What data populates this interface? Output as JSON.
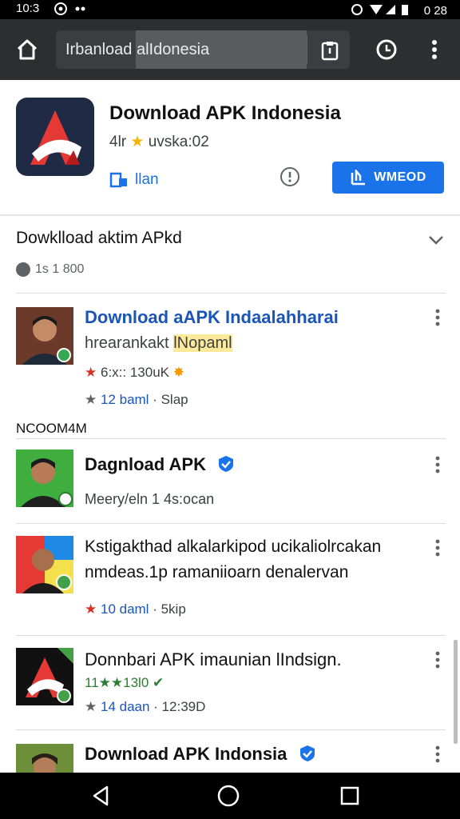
{
  "status_bar": {
    "time": "10:3",
    "battery_text": "0 28"
  },
  "browser": {
    "url": "Irbanload alIdonesia"
  },
  "app": {
    "title": "Download APK Indonesia",
    "subtitle_left": "4lr",
    "subtitle_right": "uvska:02",
    "link_label": "llan",
    "install_label": "WMEOD",
    "accent_color": "#1a73e8"
  },
  "section": {
    "title": "Dowklload aktim APkd",
    "meta": "1s 1 800"
  },
  "results_label": "NCOOM4M",
  "items": [
    {
      "title": "Download aAPK Indaalahharai",
      "line1_prefix": "hrearankakt",
      "line1_highlight": "lNopaml",
      "rating_text": "6:x:: 130uK",
      "meta_count": "12 baml",
      "meta_tail": "· Slap"
    },
    {
      "title": "Dagnload APK",
      "line1": "Meery/eln 1 4s:ocan"
    },
    {
      "title": "Kstigakthad alkalarkipod ucikaliolrcakan",
      "line1": "nmdeas.1p ramaniioarn denalervan",
      "meta_count": "10 daml",
      "meta_tail": "· 5kip"
    },
    {
      "title": "Donnbari APK imaunian lIndsign.",
      "line1": "11★★13l0",
      "meta_count": "14 daan",
      "meta_tail": "· 12:39D"
    },
    {
      "title": "Download APK Indonsia"
    }
  ]
}
